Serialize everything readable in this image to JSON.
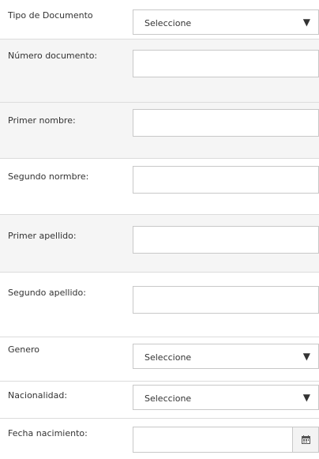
{
  "form": {
    "tipo_documento": {
      "label": "Tipo de Documento",
      "value": "Seleccione",
      "icon": "chevron-down-icon"
    },
    "numero_documento": {
      "label": "Número documento:",
      "value": ""
    },
    "primer_nombre": {
      "label": "Primer nombre:",
      "value": ""
    },
    "segundo_nombre": {
      "label": "Segundo normbre:",
      "value": ""
    },
    "primer_apellido": {
      "label": "Primer apellido:",
      "value": ""
    },
    "segundo_apellido": {
      "label": "Segundo apellido:",
      "value": ""
    },
    "genero": {
      "label": "Genero",
      "value": "Seleccione",
      "icon": "chevron-down-icon"
    },
    "nacionalidad": {
      "label": "Nacionalidad:",
      "value": "Seleccione",
      "icon": "chevron-down-icon"
    },
    "fecha_nacimiento": {
      "label": "Fecha nacimiento:",
      "value": "",
      "icon": "calendar-icon"
    }
  },
  "colors": {
    "row_shaded": "#f5f5f5",
    "border": "#c8c8c8",
    "divider": "#dcdcdc",
    "text": "#333333"
  }
}
